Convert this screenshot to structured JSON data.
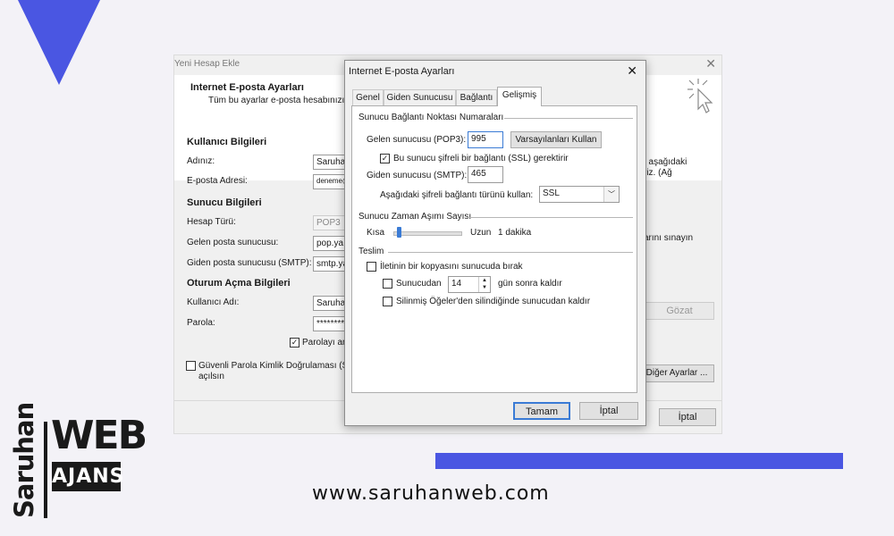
{
  "bg_window": {
    "title": "Yeni Hesap Ekle",
    "heading": "Internet E-posta Ayarları",
    "subheading": "Tüm bu ayarlar e-posta hesabınızın",
    "sections": {
      "user": "Kullanıcı Bilgileri",
      "server": "Sunucu Bilgileri",
      "login": "Oturum Açma Bilgileri"
    },
    "labels": {
      "name": "Adınız:",
      "email": "E-posta Adresi:",
      "account_type": "Hesap Türü:",
      "incoming": "Gelen posta sunucusu:",
      "outgoing": "Giden posta sunucusu (SMTP):",
      "username": "Kullanıcı Adı:",
      "password": "Parola:"
    },
    "values": {
      "name": "Saruhan",
      "email": "deneme@saruhanweb.com",
      "account_type": "POP3",
      "incoming": "pop.ya",
      "outgoing": "smtp.ya",
      "username": "Saruhan",
      "password": "********"
    },
    "remember_password": "Parolayı an",
    "spa_label": "Güvenli Parola Kimlik Doğrulaması (SPA",
    "spa_label2": "açılsın",
    "right_text1": ", aşağıdaki",
    "right_text2": "riz. (Ağ",
    "right_text3": "arını sınayın",
    "browse_button": "Gözat",
    "more_settings_button": "Diğer Ayarlar ...",
    "cancel_button": "İptal"
  },
  "dialog": {
    "title": "Internet E-posta Ayarları",
    "tabs": [
      "Genel",
      "Giden Sunucusu",
      "Bağlantı",
      "Gelişmiş"
    ],
    "active_tab": 3,
    "port_group": "Sunucu Bağlantı Noktası Numaraları",
    "incoming_label": "Gelen sunucusu (POP3):",
    "incoming_port": "995",
    "defaults_button": "Varsayılanları Kullan",
    "ssl_label": "Bu sunucu şifreli bir bağlantı (SSL) gerektirir",
    "outgoing_label": "Giden sunucusu (SMTP):",
    "outgoing_port": "465",
    "encryption_label": "Aşağıdaki şifreli bağlantı türünü kullan:",
    "encryption_value": "SSL",
    "timeout_group": "Sunucu Zaman Aşımı Sayısı",
    "short_label": "Kısa",
    "long_label": "Uzun",
    "timeout_value": "1 dakika",
    "timeout_fraction": 0.05,
    "delivery_group": "Teslim",
    "leave_copy_label": "İletinin bir kopyasını sunucuda bırak",
    "remove_after_label": "Sunucudan",
    "days_value": "14",
    "days_suffix": "gün sonra kaldır",
    "remove_deleted_label": "Silinmiş Öğeler'den silindiğinde sunucudan kaldır",
    "ok_button": "Tamam",
    "cancel_button": "İptal"
  },
  "branding": {
    "logo_vertical": "Saruhan",
    "logo_web": "WEB",
    "logo_ajans": "AJANS",
    "url": "www.saruhanweb.com",
    "accent": "#4a56e2"
  }
}
